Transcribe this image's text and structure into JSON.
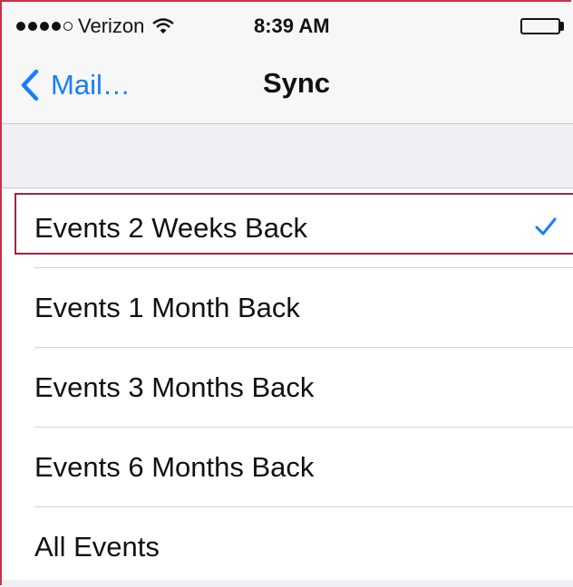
{
  "status_bar": {
    "carrier": "Verizon",
    "time": "8:39 AM",
    "signal_bars_filled": 4,
    "signal_bars_total": 5
  },
  "nav": {
    "back_label": "Mail…",
    "title": "Sync"
  },
  "options": [
    {
      "label": "Events 2 Weeks Back",
      "selected": true
    },
    {
      "label": "Events 1 Month Back",
      "selected": false
    },
    {
      "label": "Events 3 Months Back",
      "selected": false
    },
    {
      "label": "Events 6 Months Back",
      "selected": false
    },
    {
      "label": "All Events",
      "selected": false
    }
  ],
  "colors": {
    "accent": "#157efb",
    "highlight_border": "#9c2a3a",
    "group_background": "#efeff4"
  },
  "icons": {
    "back": "chevron-left-icon",
    "selected": "checkmark-icon",
    "wifi": "wifi-icon",
    "battery": "battery-icon"
  }
}
